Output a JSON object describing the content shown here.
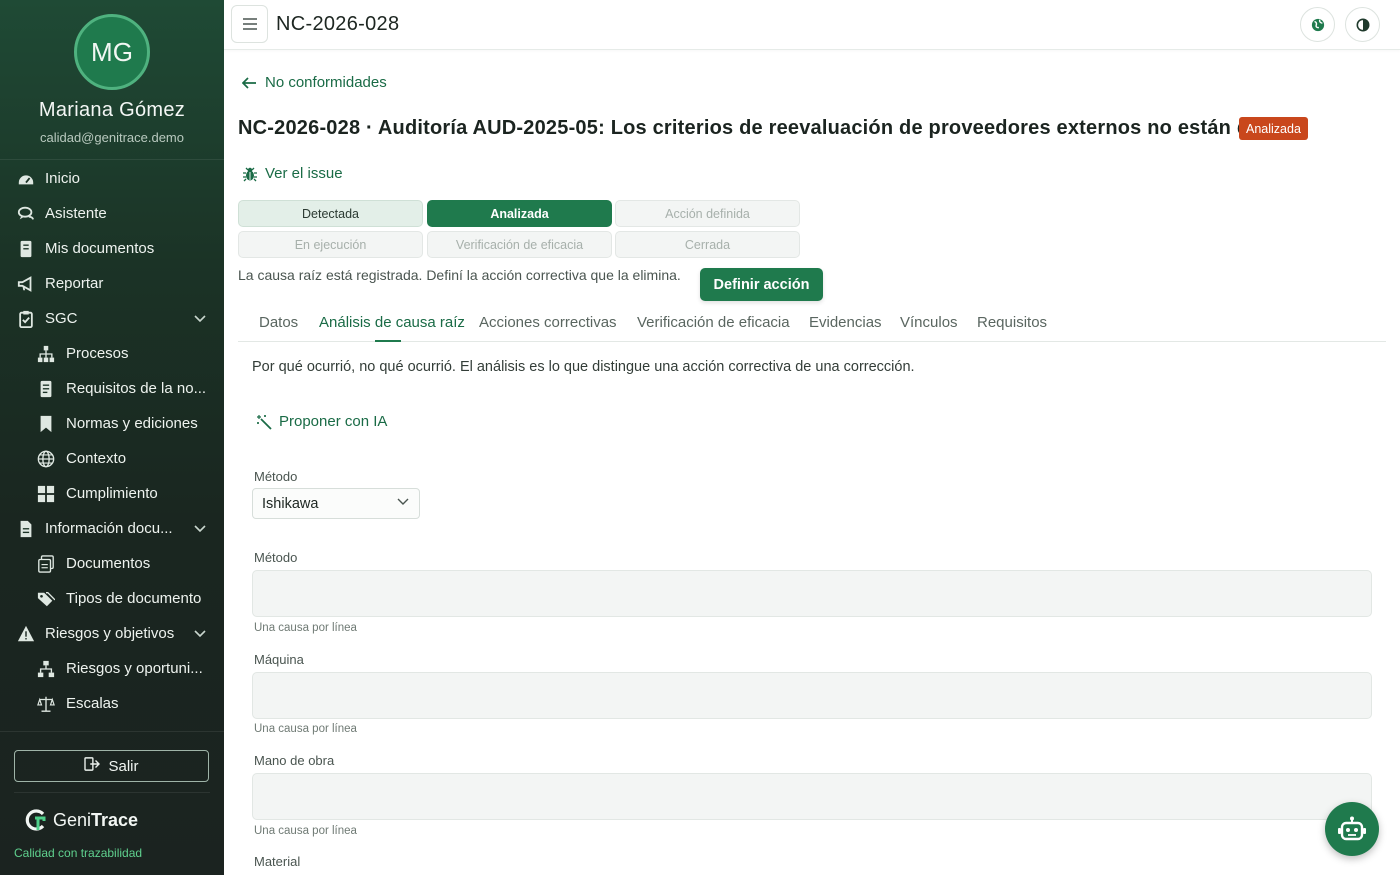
{
  "sidebar": {
    "user": {
      "initials": "MG",
      "name": "Mariana Gómez",
      "email": "calidad@genitrace.demo"
    },
    "items": [
      {
        "label": "Inicio",
        "icon": "dashboard-icon"
      },
      {
        "label": "Asistente",
        "icon": "chat-icon"
      },
      {
        "label": "Mis documentos",
        "icon": "document-icon"
      },
      {
        "label": "Reportar",
        "icon": "megaphone-icon"
      },
      {
        "label": "SGC",
        "icon": "clipboard-check-icon",
        "expanded": true
      },
      {
        "label": "Procesos",
        "icon": "sitemap-icon"
      },
      {
        "label": "Requisitos de la no...",
        "icon": "document-list-icon"
      },
      {
        "label": "Normas y ediciones",
        "icon": "bookmark-icon"
      },
      {
        "label": "Contexto",
        "icon": "globe-icon"
      },
      {
        "label": "Cumplimiento",
        "icon": "grid-icon"
      },
      {
        "label": "Información docu...",
        "icon": "file-icon",
        "expanded": true
      },
      {
        "label": "Documentos",
        "icon": "documents-stack-icon"
      },
      {
        "label": "Tipos de documento",
        "icon": "tags-icon"
      },
      {
        "label": "Riesgos y objetivos",
        "icon": "warning-icon",
        "expanded": true
      },
      {
        "label": "Riesgos y oportuni...",
        "icon": "hierarchy-icon"
      },
      {
        "label": "Escalas",
        "icon": "scale-icon"
      }
    ],
    "logout_label": "Salir",
    "brand": {
      "name_prefix": "Geni",
      "name_suffix": "Trace",
      "tagline": "Calidad con trazabilidad"
    }
  },
  "topbar": {
    "title": "NC-2026-028"
  },
  "page": {
    "back_label": "No conformidades",
    "title": "NC-2026-028 · Auditoría AUD-2025-05: Los criterios de reevaluación de proveedores externos no están d...",
    "status": "Analizada",
    "issue_link": "Ver el issue",
    "steps": [
      {
        "label": "Detectada",
        "state": "done"
      },
      {
        "label": "Analizada",
        "state": "current"
      },
      {
        "label": "Acción definida",
        "state": "pending"
      },
      {
        "label": "En ejecución",
        "state": "pending"
      },
      {
        "label": "Verificación de eficacia",
        "state": "pending"
      },
      {
        "label": "Cerrada",
        "state": "pending"
      }
    ],
    "hint": "La causa raíz está registrada. Definí la acción correctiva que la elimina.",
    "define_action": "Definir acción",
    "tabs": [
      "Datos",
      "Análisis de causa raíz",
      "Acciones correctivas",
      "Verificación de eficacia",
      "Evidencias",
      "Vínculos",
      "Requisitos"
    ],
    "active_tab": 1,
    "description": "Por qué ocurrió, no qué ocurrió. El análisis es lo que distingue una acción correctiva de una corrección.",
    "ai_button": "Proponer con IA",
    "method_label": "Método",
    "method_value": "Ishikawa",
    "fields": [
      {
        "label": "Método",
        "value": "",
        "help": "Una causa por línea"
      },
      {
        "label": "Máquina",
        "value": "",
        "help": "Una causa por línea"
      },
      {
        "label": "Mano de obra",
        "value": "",
        "help": "Una causa por línea"
      },
      {
        "label": "Material"
      }
    ]
  },
  "colors": {
    "primary": "#1f7a4d",
    "status_badge": "#c9471c",
    "link": "#1a6b46"
  }
}
